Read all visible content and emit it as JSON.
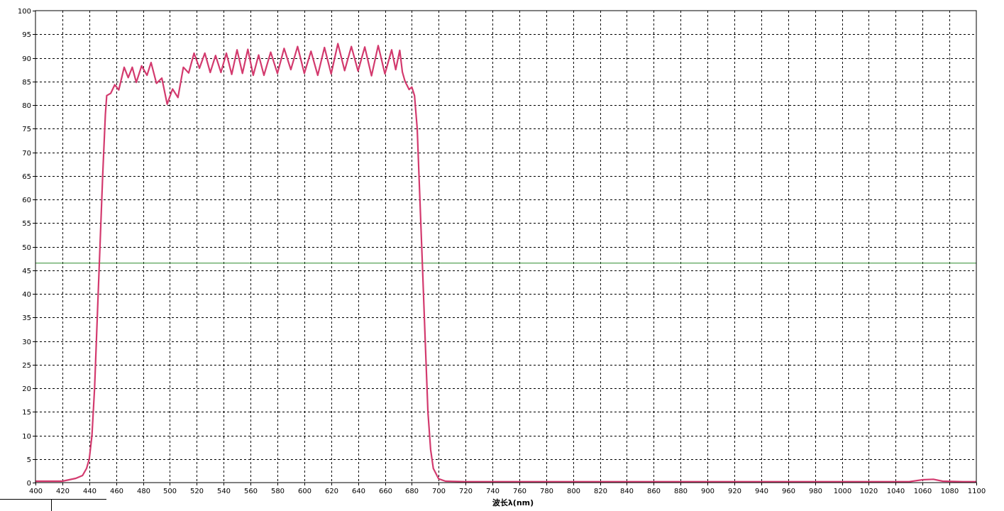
{
  "chart_data": {
    "type": "line",
    "title": "",
    "xlabel": "波长λ(nm)",
    "ylabel": "",
    "xlim": [
      400,
      1100
    ],
    "ylim": [
      0,
      100
    ],
    "grid": true,
    "x_ticks": [
      400,
      420,
      440,
      460,
      480,
      500,
      520,
      540,
      560,
      580,
      600,
      620,
      640,
      660,
      680,
      700,
      720,
      740,
      760,
      780,
      800,
      820,
      840,
      860,
      880,
      900,
      920,
      940,
      960,
      980,
      1000,
      1020,
      1040,
      1060,
      1080,
      1100
    ],
    "y_ticks": [
      0,
      5,
      10,
      15,
      20,
      25,
      30,
      35,
      40,
      45,
      50,
      55,
      60,
      65,
      70,
      75,
      80,
      85,
      90,
      95,
      100
    ],
    "reference_line": {
      "y": 46.5,
      "color": "#2e8b2e"
    },
    "series": [
      {
        "color": "#d33a6e",
        "points": [
          [
            400,
            0.3
          ],
          [
            420,
            0.3
          ],
          [
            425,
            0.6
          ],
          [
            430,
            0.9
          ],
          [
            435,
            1.5
          ],
          [
            438,
            3
          ],
          [
            440,
            5
          ],
          [
            442,
            10
          ],
          [
            444,
            20
          ],
          [
            446,
            35
          ],
          [
            448,
            50
          ],
          [
            450,
            65
          ],
          [
            452,
            78
          ],
          [
            453,
            82
          ],
          [
            456,
            82.5
          ],
          [
            459,
            84.3
          ],
          [
            462,
            83.2
          ],
          [
            466,
            88
          ],
          [
            469,
            85.8
          ],
          [
            472,
            88
          ],
          [
            475,
            84.8
          ],
          [
            479,
            88.3
          ],
          [
            483,
            86.3
          ],
          [
            486,
            89
          ],
          [
            490,
            84.6
          ],
          [
            494,
            85.7
          ],
          [
            498,
            80.2
          ],
          [
            502,
            83.4
          ],
          [
            506,
            81.6
          ],
          [
            510,
            88
          ],
          [
            514,
            86.8
          ],
          [
            518,
            91
          ],
          [
            522,
            87.8
          ],
          [
            526,
            91
          ],
          [
            530,
            86.9
          ],
          [
            534,
            90.5
          ],
          [
            538,
            86.9
          ],
          [
            542,
            91
          ],
          [
            546,
            86.5
          ],
          [
            550,
            91.7
          ],
          [
            554,
            86.7
          ],
          [
            558,
            91.8
          ],
          [
            562,
            86.3
          ],
          [
            566,
            90.6
          ],
          [
            570,
            86.3
          ],
          [
            575,
            91.2
          ],
          [
            580,
            86.7
          ],
          [
            585,
            92
          ],
          [
            590,
            87.5
          ],
          [
            595,
            92.4
          ],
          [
            600,
            86.7
          ],
          [
            605,
            91.4
          ],
          [
            610,
            86.3
          ],
          [
            615,
            92.2
          ],
          [
            620,
            86.6
          ],
          [
            625,
            93
          ],
          [
            630,
            87.3
          ],
          [
            635,
            92.4
          ],
          [
            640,
            87.2
          ],
          [
            645,
            92.3
          ],
          [
            650,
            86.2
          ],
          [
            655,
            92.6
          ],
          [
            660,
            86.6
          ],
          [
            665,
            91.7
          ],
          [
            668,
            87.5
          ],
          [
            671,
            91.6
          ],
          [
            673,
            87
          ],
          [
            675,
            85
          ],
          [
            678,
            83.3
          ],
          [
            680,
            83.8
          ],
          [
            682,
            82
          ],
          [
            684,
            75
          ],
          [
            686,
            60
          ],
          [
            688,
            45
          ],
          [
            690,
            30
          ],
          [
            692,
            15
          ],
          [
            694,
            7
          ],
          [
            696,
            3
          ],
          [
            700,
            0.8
          ],
          [
            705,
            0.3
          ],
          [
            720,
            0.2
          ],
          [
            800,
            0.2
          ],
          [
            1000,
            0.2
          ],
          [
            1050,
            0.2
          ],
          [
            1060,
            0.6
          ],
          [
            1068,
            0.7
          ],
          [
            1075,
            0.3
          ],
          [
            1090,
            0.2
          ],
          [
            1100,
            0.2
          ]
        ]
      }
    ]
  }
}
